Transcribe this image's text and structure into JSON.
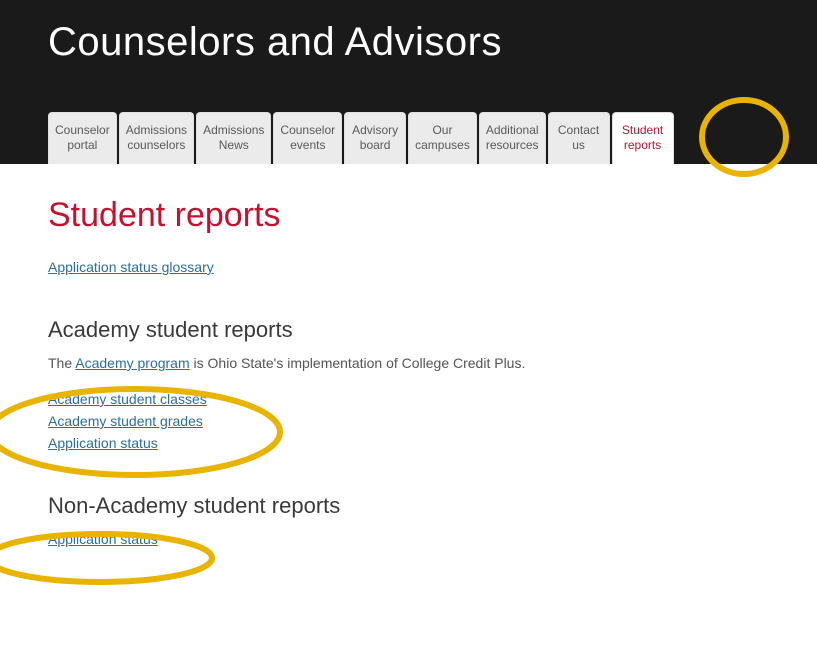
{
  "banner_title": "Counselors and Advisors",
  "tabs": [
    {
      "line1": "Counselor",
      "line2": "portal",
      "active": false
    },
    {
      "line1": "Admissions",
      "line2": "counselors",
      "active": false
    },
    {
      "line1": "Admissions",
      "line2": "News",
      "active": false
    },
    {
      "line1": "Counselor",
      "line2": "events",
      "active": false
    },
    {
      "line1": "Advisory",
      "line2": "board",
      "active": false
    },
    {
      "line1": "Our",
      "line2": "campuses",
      "active": false
    },
    {
      "line1": "Additional",
      "line2": "resources",
      "active": false
    },
    {
      "line1": "Contact",
      "line2": "us",
      "active": false
    },
    {
      "line1": "Student",
      "line2": "reports",
      "active": true
    }
  ],
  "page_title": "Student reports",
  "glossary_link": "Application status glossary",
  "academy": {
    "heading": "Academy student reports",
    "intro_prefix": "The ",
    "intro_link": "Academy program",
    "intro_suffix": " is Ohio State's implementation of College Credit Plus.",
    "links": [
      "Academy student classes",
      "Academy student grades",
      "Application status"
    ]
  },
  "non_academy": {
    "heading": "Non-Academy student reports",
    "links": [
      "Application status"
    ]
  },
  "colors": {
    "scarlet": "#c8102e",
    "link_blue": "#2a6ea6",
    "highlight_yellow": "#e8b400"
  }
}
